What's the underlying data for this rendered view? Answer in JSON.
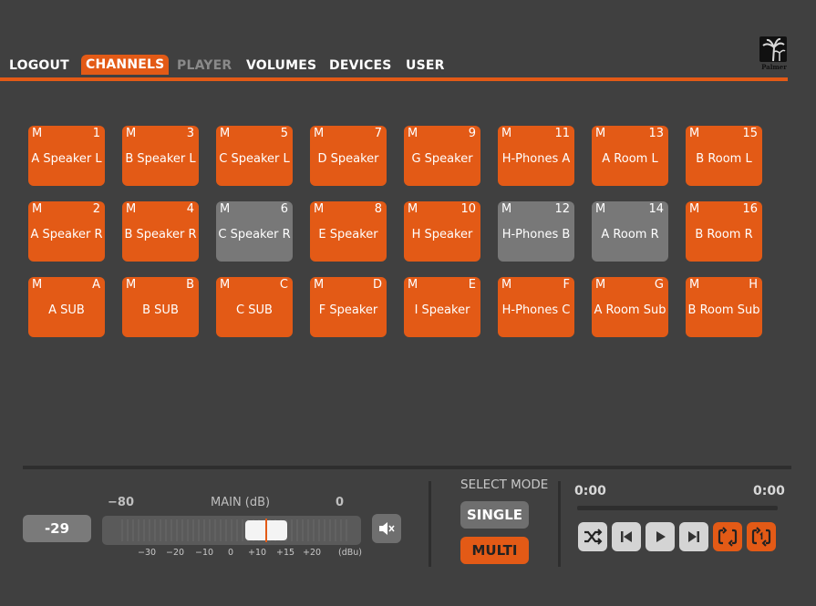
{
  "nav": {
    "items": [
      {
        "label": "LOGOUT",
        "state": "normal"
      },
      {
        "label": "CHANNELS",
        "state": "active"
      },
      {
        "label": "PLAYER",
        "state": "dim"
      },
      {
        "label": "VOLUMES",
        "state": "normal"
      },
      {
        "label": "DEVICES",
        "state": "normal"
      },
      {
        "label": "USER",
        "state": "normal"
      }
    ],
    "logo_text": "Palmer"
  },
  "channels": [
    [
      {
        "m": "M",
        "num": "1",
        "label": "A Speaker L",
        "on": true
      },
      {
        "m": "M",
        "num": "3",
        "label": "B Speaker L",
        "on": true
      },
      {
        "m": "M",
        "num": "5",
        "label": "C Speaker L",
        "on": true
      },
      {
        "m": "M",
        "num": "7",
        "label": "D Speaker",
        "on": true
      },
      {
        "m": "M",
        "num": "9",
        "label": "G Speaker",
        "on": true
      },
      {
        "m": "M",
        "num": "11",
        "label": "H-Phones A",
        "on": true
      },
      {
        "m": "M",
        "num": "13",
        "label": "A Room L",
        "on": true
      },
      {
        "m": "M",
        "num": "15",
        "label": "B Room L",
        "on": true
      }
    ],
    [
      {
        "m": "M",
        "num": "2",
        "label": "A Speaker R",
        "on": true
      },
      {
        "m": "M",
        "num": "4",
        "label": "B Speaker R",
        "on": true
      },
      {
        "m": "M",
        "num": "6",
        "label": "C Speaker R",
        "on": false
      },
      {
        "m": "M",
        "num": "8",
        "label": "E Speaker",
        "on": true
      },
      {
        "m": "M",
        "num": "10",
        "label": "H Speaker",
        "on": true
      },
      {
        "m": "M",
        "num": "12",
        "label": "H-Phones B",
        "on": false
      },
      {
        "m": "M",
        "num": "14",
        "label": "A Room R",
        "on": false
      },
      {
        "m": "M",
        "num": "16",
        "label": "B Room R",
        "on": true
      }
    ],
    [
      {
        "m": "M",
        "num": "A",
        "label": "A SUB",
        "on": true
      },
      {
        "m": "M",
        "num": "B",
        "label": "B SUB",
        "on": true
      },
      {
        "m": "M",
        "num": "C",
        "label": "C SUB",
        "on": true
      },
      {
        "m": "M",
        "num": "D",
        "label": "F Speaker",
        "on": true
      },
      {
        "m": "M",
        "num": "E",
        "label": "I Speaker",
        "on": true
      },
      {
        "m": "M",
        "num": "F",
        "label": "H-Phones C",
        "on": true
      },
      {
        "m": "M",
        "num": "G",
        "label": "A Room Sub",
        "on": true
      },
      {
        "m": "M",
        "num": "H",
        "label": "B Room Sub",
        "on": true
      }
    ]
  ],
  "volume": {
    "readout": "-29",
    "min_label": "−80",
    "title": "MAIN (dB)",
    "max_label": "0",
    "level_fraction": 0.66,
    "ticks": [
      "−30",
      "−20",
      "−10",
      "0",
      "+10",
      "+15",
      "+20",
      "(dBu)"
    ],
    "mute_icon": "speaker-mute-icon"
  },
  "select_mode": {
    "title": "SELECT MODE",
    "single_label": "SINGLE",
    "multi_label": "MULTI",
    "selected": "MULTI"
  },
  "player": {
    "time_current": "0:00",
    "time_total": "0:00",
    "progress": 0,
    "controls": [
      {
        "name": "shuffle-icon",
        "on": false
      },
      {
        "name": "previous-icon",
        "on": false
      },
      {
        "name": "play-icon",
        "on": false
      },
      {
        "name": "next-icon",
        "on": false
      },
      {
        "name": "repeat-icon",
        "on": true
      },
      {
        "name": "repeat-one-icon",
        "on": true
      }
    ]
  },
  "colors": {
    "accent": "#e35a16",
    "off": "#787878",
    "bg": "#404040"
  }
}
